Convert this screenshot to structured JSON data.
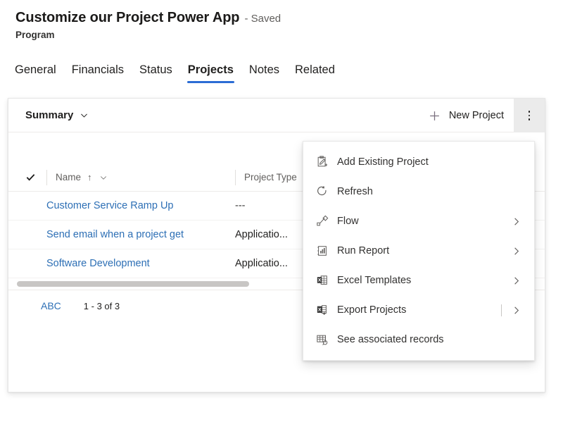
{
  "header": {
    "title": "Customize our Project Power App",
    "saved_status": "- Saved",
    "entity_type": "Program"
  },
  "tabs": [
    {
      "label": "General",
      "selected": false
    },
    {
      "label": "Financials",
      "selected": false
    },
    {
      "label": "Status",
      "selected": false
    },
    {
      "label": "Projects",
      "selected": true
    },
    {
      "label": "Notes",
      "selected": false
    },
    {
      "label": "Related",
      "selected": false
    }
  ],
  "accent_color": "#2b6cd4",
  "link_color": "#2d6fb5",
  "commandbar": {
    "view_name": "Summary",
    "view_chevron_icon": "chevron-down-icon",
    "new_button_label": "New Project",
    "new_button_icon": "plus-icon",
    "overflow_icon": "more-vertical-icon"
  },
  "grid": {
    "columns": [
      {
        "label": "Name",
        "sort_indicator": "↑",
        "menu_icon": "chevron-down-icon"
      },
      {
        "label": "Project Type",
        "sort_indicator": "",
        "menu_icon": "chevron-down-icon"
      }
    ],
    "select_all_icon": "checkmark-icon",
    "rows": [
      {
        "name": "Customer Service Ramp Up",
        "project_type": "---"
      },
      {
        "name": "Send email when a project  get",
        "project_type": "Applicatio..."
      },
      {
        "name": "Software Development",
        "project_type": "Applicatio..."
      }
    ],
    "footer": {
      "alpha_index_label": "ABC",
      "record_range": "1 - 3 of 3"
    }
  },
  "context_menu": {
    "items": [
      {
        "label": "Add Existing Project",
        "icon": "add-existing-record-icon",
        "has_submenu": false,
        "split": false
      },
      {
        "label": "Refresh",
        "icon": "refresh-icon",
        "has_submenu": false,
        "split": false
      },
      {
        "label": "Flow",
        "icon": "flow-icon",
        "has_submenu": true,
        "split": false
      },
      {
        "label": "Run Report",
        "icon": "run-report-icon",
        "has_submenu": true,
        "split": false
      },
      {
        "label": "Excel Templates",
        "icon": "excel-template-icon",
        "has_submenu": true,
        "split": false
      },
      {
        "label": "Export Projects",
        "icon": "export-excel-icon",
        "has_submenu": true,
        "split": true
      },
      {
        "label": "See associated records",
        "icon": "associated-records-icon",
        "has_submenu": false,
        "split": false
      }
    ],
    "submenu_chevron_icon": "chevron-right-icon"
  }
}
